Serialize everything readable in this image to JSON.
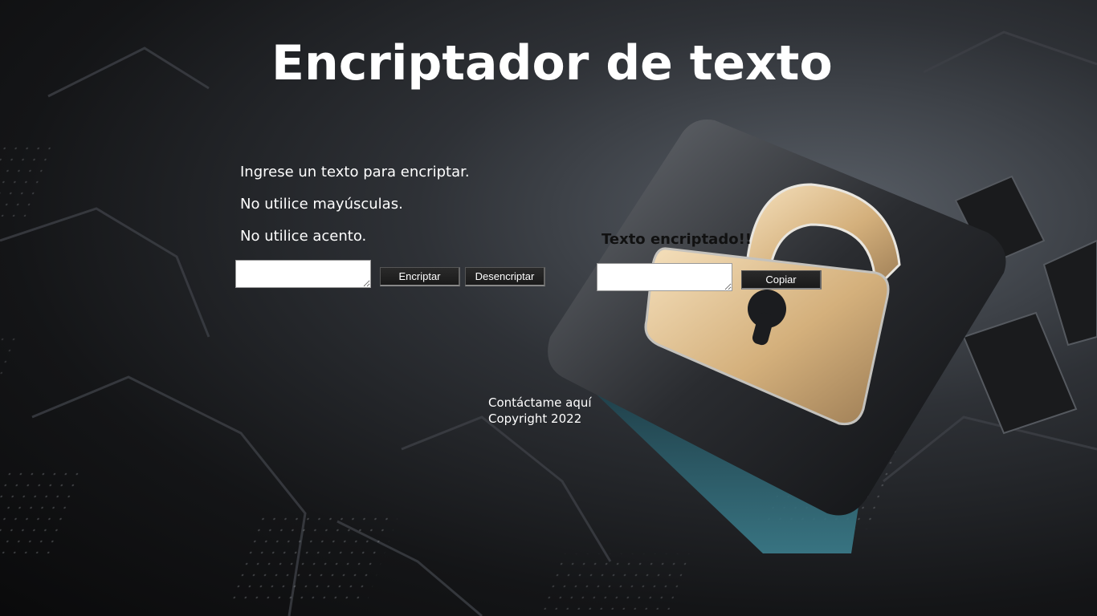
{
  "header": {
    "title": "Encriptador de texto"
  },
  "instructions": [
    "Ingrese un texto para encriptar.",
    "No utilice mayúsculas.",
    "No utilice acento."
  ],
  "input": {
    "value": "",
    "placeholder": ""
  },
  "buttons": {
    "encrypt": "Encriptar",
    "decrypt": "Desencriptar",
    "copy": "Copiar"
  },
  "output": {
    "title": "Texto encriptado!!",
    "value": ""
  },
  "footer": {
    "contact": "Contáctame aquí",
    "copyright": "Copyright 2022"
  },
  "colors": {
    "text": "#ffffff",
    "lock_gold": "#d9b98a",
    "button_bg": "#1f1f1f"
  },
  "icons": {
    "hero": "padlock-icon"
  }
}
